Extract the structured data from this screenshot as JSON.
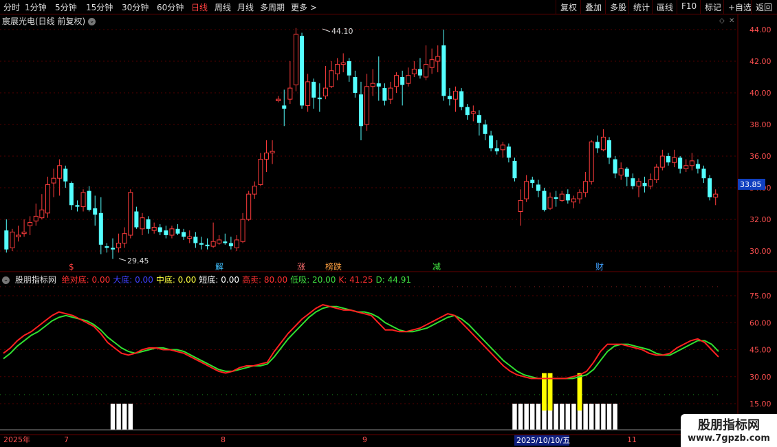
{
  "toolbar": {
    "left": [
      "分时",
      "1分钟",
      "5分钟",
      "15分钟",
      "30分钟",
      "60分钟",
      "日线",
      "周线",
      "月线",
      "多周期",
      "更多 >"
    ],
    "active": "日线",
    "right": [
      "复权",
      "叠加",
      "多股",
      "统计",
      "画线",
      "F10",
      "标记",
      "+自选",
      "返回"
    ]
  },
  "title": "宸展光电(日线 前复权)",
  "price_axis": [
    "44.00",
    "42.00",
    "40.00",
    "38.00",
    "36.00",
    "34.00",
    "32.00",
    "30.00"
  ],
  "current_price": "33.85",
  "high_label": "44.10",
  "low_label": "29.45",
  "event_markers": [
    {
      "text": "$",
      "color": "#ff4040"
    },
    {
      "text": "解",
      "color": "#40c0ff"
    },
    {
      "text": "涨",
      "color": "#ff7070"
    },
    {
      "text": "榜跌",
      "color": "#ffa040"
    },
    {
      "text": "减",
      "color": "#40e040"
    },
    {
      "text": "财",
      "color": "#40a0ff"
    }
  ],
  "indicator": {
    "name": "股朋指标网",
    "items": [
      {
        "label": "绝对底:",
        "value": "0.00",
        "color": "#ff3030"
      },
      {
        "label": "大底:",
        "value": "0.00",
        "color": "#4040ff"
      },
      {
        "label": "中底:",
        "value": "0.00",
        "color": "#ffff40"
      },
      {
        "label": "短底:",
        "value": "0.00",
        "color": "#ffffff"
      },
      {
        "label": "高卖:",
        "value": "80.00",
        "color": "#ff3030"
      },
      {
        "label": "低吸:",
        "value": "20.00",
        "color": "#40e040"
      },
      {
        "label": "K:",
        "value": "41.25",
        "color": "#ff3030"
      },
      {
        "label": "D:",
        "value": "44.91",
        "color": "#40e040"
      }
    ],
    "axis": [
      "75.00",
      "60.00",
      "45.00",
      "30.00",
      "15.00"
    ]
  },
  "date_axis": {
    "labels": [
      "2025年",
      "7",
      "8",
      "9",
      "11"
    ],
    "selected": "2025/10/10/五"
  },
  "watermark": {
    "line1": "股朋指标网",
    "line2": "www.7gpzb.com"
  },
  "colors": {
    "up": "#ff3c3c",
    "down": "#54ffff",
    "k_line": "#ff2020",
    "d_line": "#30e030"
  },
  "chart_data": {
    "type": "candlestick",
    "ylim": [
      29,
      44.6
    ],
    "candles": [
      [
        31.3,
        30.1,
        32.0,
        29.9
      ],
      [
        30.2,
        31.2,
        31.4,
        30.0
      ],
      [
        30.9,
        31.0,
        31.6,
        30.6
      ],
      [
        31.1,
        31.2,
        32.0,
        30.9
      ],
      [
        31.6,
        31.8,
        32.2,
        31.0
      ],
      [
        31.9,
        32.2,
        33.0,
        31.6
      ],
      [
        32.1,
        32.6,
        33.6,
        32.0
      ],
      [
        32.4,
        34.2,
        34.7,
        32.1
      ],
      [
        34.3,
        34.6,
        35.2,
        33.4
      ],
      [
        34.6,
        35.4,
        35.8,
        33.5
      ],
      [
        35.2,
        34.4,
        35.4,
        34.0
      ],
      [
        34.3,
        32.9,
        34.4,
        32.6
      ],
      [
        32.9,
        32.8,
        33.2,
        32.5
      ],
      [
        32.8,
        33.7,
        33.9,
        32.5
      ],
      [
        33.8,
        32.6,
        34.1,
        32.5
      ],
      [
        32.7,
        32.3,
        33.5,
        31.6
      ],
      [
        32.4,
        30.4,
        33.4,
        29.8
      ],
      [
        30.3,
        30.2,
        30.5,
        29.9
      ],
      [
        30.2,
        30.1,
        30.8,
        29.5
      ],
      [
        30.2,
        30.5,
        31.1,
        29.9
      ],
      [
        30.5,
        31.1,
        31.5,
        30.2
      ],
      [
        31.0,
        33.7,
        33.9,
        30.8
      ],
      [
        32.5,
        31.5,
        32.8,
        31.4
      ],
      [
        31.4,
        32.1,
        32.4,
        31.0
      ],
      [
        32.0,
        31.4,
        32.2,
        31.1
      ],
      [
        31.3,
        31.5,
        31.8,
        31.1
      ],
      [
        31.5,
        31.2,
        31.7,
        31.0
      ],
      [
        31.3,
        31.0,
        31.6,
        30.8
      ],
      [
        31.0,
        31.4,
        31.6,
        30.8
      ],
      [
        31.4,
        31.1,
        31.7,
        31.0
      ],
      [
        31.2,
        30.9,
        31.4,
        30.7
      ],
      [
        30.8,
        30.9,
        31.3,
        30.5
      ],
      [
        30.9,
        30.5,
        31.2,
        30.2
      ],
      [
        30.5,
        30.4,
        30.9,
        30.1
      ],
      [
        30.4,
        30.3,
        30.8,
        30.1
      ],
      [
        30.3,
        30.6,
        31.8,
        30.2
      ],
      [
        30.5,
        30.7,
        31.0,
        30.4
      ],
      [
        30.6,
        30.5,
        31.1,
        30.4
      ],
      [
        30.5,
        30.3,
        30.9,
        30.1
      ],
      [
        30.2,
        30.7,
        31.0,
        30.0
      ],
      [
        30.6,
        32.0,
        32.4,
        30.5
      ],
      [
        32.0,
        33.6,
        33.8,
        31.9
      ],
      [
        33.6,
        34.1,
        34.4,
        33.3
      ],
      [
        34.2,
        35.8,
        36.2,
        34.1
      ],
      [
        35.8,
        36.2,
        37.0,
        35.0
      ],
      [
        36.2,
        36.3,
        37.0,
        35.5
      ],
      [
        39.5,
        39.6,
        39.8,
        39.4
      ],
      [
        39.2,
        39.0,
        40.2,
        37.9
      ],
      [
        39.6,
        40.3,
        42.0,
        39.3
      ],
      [
        40.5,
        43.7,
        44.1,
        40.1
      ],
      [
        43.6,
        39.2,
        43.8,
        39.0
      ],
      [
        39.2,
        40.7,
        41.2,
        38.8
      ],
      [
        40.7,
        39.7,
        40.9,
        39.0
      ],
      [
        39.7,
        39.6,
        40.6,
        38.8
      ],
      [
        39.8,
        40.3,
        41.7,
        39.6
      ],
      [
        40.4,
        41.4,
        42.0,
        40.3
      ],
      [
        41.2,
        41.8,
        42.2,
        40.8
      ],
      [
        41.8,
        41.9,
        42.5,
        41.3
      ],
      [
        42.0,
        41.1,
        42.2,
        40.7
      ],
      [
        41.0,
        40.0,
        41.4,
        39.7
      ],
      [
        39.9,
        37.9,
        40.7,
        37.0
      ],
      [
        38.0,
        40.4,
        41.2,
        37.6
      ],
      [
        40.4,
        40.6,
        41.5,
        39.8
      ],
      [
        40.6,
        40.4,
        42.3,
        39.5
      ],
      [
        40.3,
        39.5,
        40.6,
        39.2
      ],
      [
        39.6,
        40.3,
        40.7,
        39.3
      ],
      [
        40.4,
        41.1,
        41.3,
        40.0
      ],
      [
        41.0,
        40.5,
        41.4,
        39.2
      ],
      [
        40.6,
        41.1,
        41.6,
        40.4
      ],
      [
        41.2,
        41.5,
        42.0,
        41.0
      ],
      [
        41.5,
        41.1,
        42.2,
        40.9
      ],
      [
        41.0,
        41.8,
        43.0,
        40.8
      ],
      [
        41.6,
        42.1,
        42.8,
        41.2
      ],
      [
        42.0,
        42.3,
        43.0,
        41.3
      ],
      [
        43.0,
        39.8,
        44.0,
        39.5
      ],
      [
        39.8,
        39.6,
        40.3,
        39.2
      ],
      [
        39.6,
        40.1,
        40.4,
        38.8
      ],
      [
        40.1,
        39.1,
        40.3,
        38.9
      ],
      [
        39.1,
        38.6,
        39.3,
        38.3
      ],
      [
        38.7,
        38.8,
        39.2,
        38.2
      ],
      [
        38.6,
        38.1,
        38.9,
        37.3
      ],
      [
        38.0,
        37.4,
        38.3,
        37.0
      ],
      [
        37.3,
        36.5,
        37.6,
        36.3
      ],
      [
        36.5,
        36.3,
        37.0,
        36.1
      ],
      [
        36.4,
        36.7,
        36.9,
        35.9
      ],
      [
        36.6,
        35.9,
        36.8,
        35.6
      ],
      [
        35.7,
        34.6,
        35.9,
        34.4
      ],
      [
        32.5,
        33.2,
        33.9,
        31.6
      ],
      [
        33.3,
        34.4,
        34.8,
        33.1
      ],
      [
        34.5,
        34.3,
        34.7,
        34.0
      ],
      [
        34.2,
        33.8,
        34.5,
        33.4
      ],
      [
        33.8,
        32.6,
        34.0,
        32.5
      ],
      [
        32.7,
        33.4,
        33.7,
        32.6
      ],
      [
        33.4,
        33.3,
        33.8,
        32.8
      ],
      [
        33.2,
        33.6,
        33.8,
        33.1
      ],
      [
        33.6,
        33.2,
        33.9,
        33.0
      ],
      [
        33.1,
        33.3,
        33.5,
        32.7
      ],
      [
        33.3,
        33.7,
        33.9,
        33.0
      ],
      [
        33.7,
        34.4,
        35.0,
        33.4
      ],
      [
        34.4,
        36.9,
        37.0,
        34.2
      ],
      [
        36.9,
        36.5,
        37.3,
        36.2
      ],
      [
        36.4,
        37.2,
        37.7,
        36.3
      ],
      [
        37.0,
        35.9,
        37.2,
        35.5
      ],
      [
        35.8,
        34.9,
        36.0,
        34.6
      ],
      [
        34.8,
        35.2,
        35.6,
        34.5
      ],
      [
        35.2,
        34.7,
        35.3,
        34.1
      ],
      [
        34.6,
        34.1,
        34.9,
        33.9
      ],
      [
        34.1,
        34.4,
        34.6,
        33.4
      ],
      [
        34.3,
        34.1,
        34.7,
        33.7
      ],
      [
        34.1,
        34.5,
        34.9,
        33.9
      ],
      [
        34.5,
        35.3,
        35.5,
        34.3
      ],
      [
        35.3,
        36.0,
        36.4,
        35.1
      ],
      [
        36.0,
        35.6,
        36.2,
        35.4
      ],
      [
        35.6,
        35.9,
        36.4,
        35.3
      ],
      [
        35.9,
        35.2,
        36.0,
        34.9
      ],
      [
        35.2,
        35.4,
        35.8,
        35.0
      ],
      [
        35.4,
        35.7,
        36.2,
        35.1
      ],
      [
        35.5,
        35.2,
        35.8,
        34.9
      ],
      [
        35.2,
        34.6,
        35.4,
        34.3
      ],
      [
        34.6,
        33.4,
        34.8,
        33.2
      ],
      [
        33.4,
        33.6,
        33.9,
        32.9
      ]
    ],
    "k_values": [
      43,
      46,
      50,
      53,
      55,
      58,
      61,
      64,
      66,
      65,
      64,
      62,
      60,
      58,
      54,
      49,
      46,
      43,
      42,
      43,
      45,
      46,
      46,
      45,
      45,
      44,
      43,
      41,
      39,
      37,
      35,
      33,
      32,
      33,
      35,
      36,
      36,
      37,
      38,
      44,
      49,
      54,
      58,
      62,
      65,
      68,
      70,
      69,
      68,
      67,
      67,
      66,
      65,
      64,
      60,
      56,
      56,
      55,
      55,
      56,
      57,
      59,
      61,
      63,
      65,
      64,
      60,
      56,
      52,
      48,
      44,
      40,
      36,
      33,
      31,
      30,
      29,
      29,
      29,
      29,
      29,
      29,
      30,
      31,
      33,
      38,
      44,
      48,
      48,
      48,
      47,
      46,
      45,
      43,
      42,
      42,
      43,
      46,
      48,
      50,
      51,
      49,
      45,
      41
    ],
    "d_values": [
      40,
      43,
      47,
      50,
      53,
      55,
      58,
      61,
      63,
      64,
      63,
      62,
      61,
      59,
      56,
      52,
      49,
      46,
      44,
      43,
      44,
      45,
      46,
      46,
      45,
      45,
      44,
      42,
      40,
      38,
      36,
      34,
      33,
      33,
      34,
      35,
      36,
      36,
      37,
      41,
      46,
      51,
      55,
      59,
      63,
      66,
      68,
      69,
      69,
      68,
      67,
      66,
      66,
      65,
      63,
      60,
      58,
      56,
      55,
      55,
      56,
      57,
      59,
      61,
      63,
      64,
      62,
      59,
      55,
      51,
      47,
      43,
      39,
      36,
      33,
      31,
      30,
      29,
      29,
      29,
      29,
      29,
      29,
      30,
      31,
      34,
      39,
      44,
      47,
      48,
      48,
      47,
      46,
      45,
      43,
      42,
      42,
      44,
      46,
      48,
      50,
      50,
      48,
      44
    ],
    "kd_ylim": [
      8,
      88
    ],
    "bars_white": [
      18,
      19,
      20,
      21,
      86,
      87,
      88,
      89,
      90,
      91,
      92,
      93,
      94,
      95,
      96,
      97,
      98,
      99,
      100,
      101,
      102,
      103
    ],
    "bars_yellow": [
      91,
      92,
      97
    ]
  }
}
